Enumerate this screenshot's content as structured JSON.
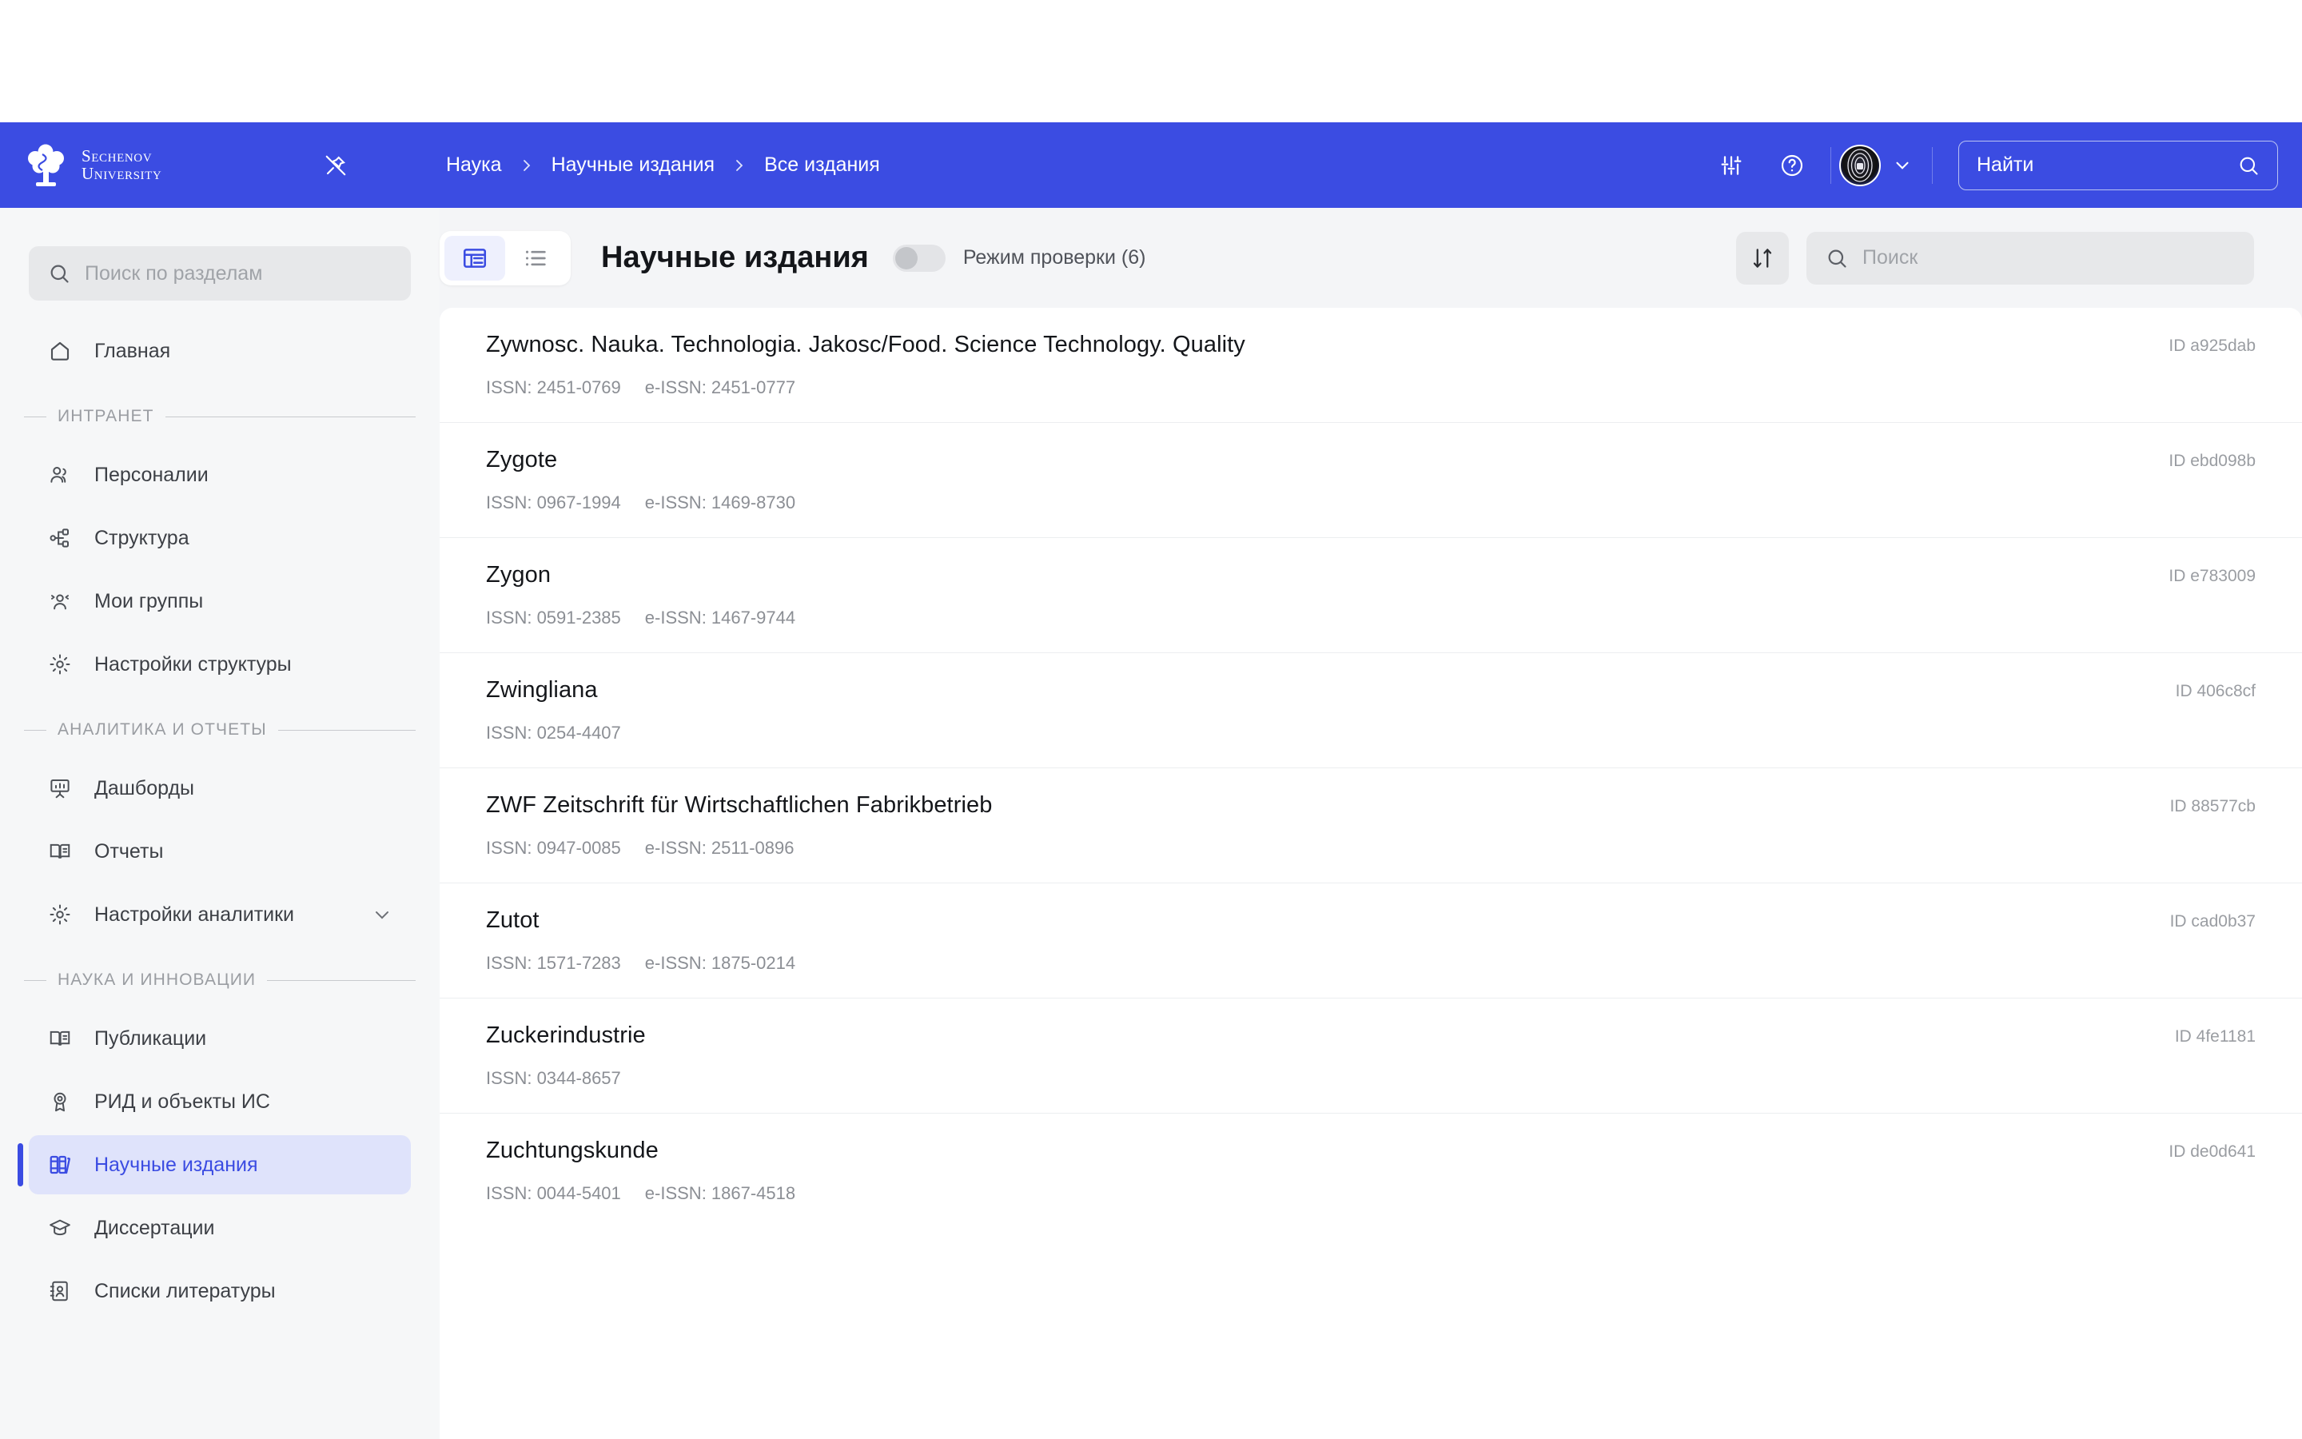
{
  "colors": {
    "brand": "#3b4ce2",
    "active_bg": "#dfe3fb",
    "page_bg": "#f4f5f7",
    "sidebar_bg": "#f6f7f8"
  },
  "header": {
    "logo_line1": "Sechenov",
    "logo_line2": "University",
    "pin_icon": "pin-off-icon",
    "breadcrumb": [
      {
        "label": "Наука"
      },
      {
        "label": "Научные издания"
      },
      {
        "label": "Все издания"
      }
    ],
    "settings_icon": "sliders-icon",
    "help_icon": "help-circle-icon",
    "avatar_icon": "user-avatar",
    "chevron_icon": "chevron-down-icon",
    "search": {
      "placeholder": "Найти",
      "value": "",
      "icon": "search-icon"
    }
  },
  "sidebar": {
    "search": {
      "placeholder": "Поиск по разделам",
      "value": "",
      "icon": "search-icon"
    },
    "items": [
      {
        "type": "item",
        "label": "Главная",
        "icon": "home-icon",
        "active": false
      },
      {
        "type": "group",
        "label": "ИНТРАНЕТ"
      },
      {
        "type": "item",
        "label": "Персоналии",
        "icon": "users-icon",
        "active": false
      },
      {
        "type": "item",
        "label": "Структура",
        "icon": "org-chart-icon",
        "active": false
      },
      {
        "type": "item",
        "label": "Мои группы",
        "icon": "user-group-icon",
        "active": false
      },
      {
        "type": "item",
        "label": "Настройки структуры",
        "icon": "gear-icon",
        "active": false
      },
      {
        "type": "group",
        "label": "АНАЛИТИКА И ОТЧЕТЫ"
      },
      {
        "type": "item",
        "label": "Дашборды",
        "icon": "presentation-chart-icon",
        "active": false
      },
      {
        "type": "item",
        "label": "Отчеты",
        "icon": "book-open-icon",
        "active": false
      },
      {
        "type": "item",
        "label": "Настройки аналитики",
        "icon": "gear-icon",
        "active": false,
        "expandable": true
      },
      {
        "type": "group",
        "label": "НАУКА И ИННОВАЦИИ"
      },
      {
        "type": "item",
        "label": "Публикации",
        "icon": "book-open-icon",
        "active": false
      },
      {
        "type": "item",
        "label": "РИД и объекты ИС",
        "icon": "award-icon",
        "active": false
      },
      {
        "type": "item",
        "label": "Научные издания",
        "icon": "books-icon",
        "active": true
      },
      {
        "type": "item",
        "label": "Диссертации",
        "icon": "graduation-cap-icon",
        "active": false
      },
      {
        "type": "item",
        "label": "Списки литературы",
        "icon": "address-book-icon",
        "active": false
      }
    ]
  },
  "toolbar": {
    "view_table_icon": "table-view-icon",
    "view_list_icon": "list-view-icon",
    "selected_view": "table",
    "title": "Научные издания",
    "check_mode_label": "Режим проверки (6)",
    "check_mode_on": false,
    "sort_icon": "sort-icon",
    "search": {
      "placeholder": "Поиск",
      "value": "",
      "icon": "search-icon"
    }
  },
  "list": {
    "id_prefix": "ID",
    "issn_label": "ISSN:",
    "eissn_label": "e-ISSN:",
    "rows": [
      {
        "title": "Zywnosc. Nauka. Technologia. Jakosc/Food. Science Technology. Quality",
        "issn": "ISSN: 2451-0769",
        "eissn": "e-ISSN: 2451-0777",
        "id": "ID a925dab"
      },
      {
        "title": "Zygote",
        "issn": "ISSN: 0967-1994",
        "eissn": "e-ISSN: 1469-8730",
        "id": "ID ebd098b"
      },
      {
        "title": "Zygon",
        "issn": "ISSN: 0591-2385",
        "eissn": "e-ISSN: 1467-9744",
        "id": "ID e783009"
      },
      {
        "title": "Zwingliana",
        "issn": "ISSN: 0254-4407",
        "eissn": "",
        "id": "ID 406c8cf"
      },
      {
        "title": "ZWF Zeitschrift für Wirtschaftlichen Fabrikbetrieb",
        "issn": "ISSN: 0947-0085",
        "eissn": "e-ISSN: 2511-0896",
        "id": "ID 88577cb"
      },
      {
        "title": "Zutot",
        "issn": "ISSN: 1571-7283",
        "eissn": "e-ISSN: 1875-0214",
        "id": "ID cad0b37"
      },
      {
        "title": "Zuckerindustrie",
        "issn": "ISSN: 0344-8657",
        "eissn": "",
        "id": "ID 4fe1181"
      },
      {
        "title": "Zuchtungskunde",
        "issn": "ISSN: 0044-5401",
        "eissn": "e-ISSN: 1867-4518",
        "id": "ID de0d641"
      }
    ]
  }
}
